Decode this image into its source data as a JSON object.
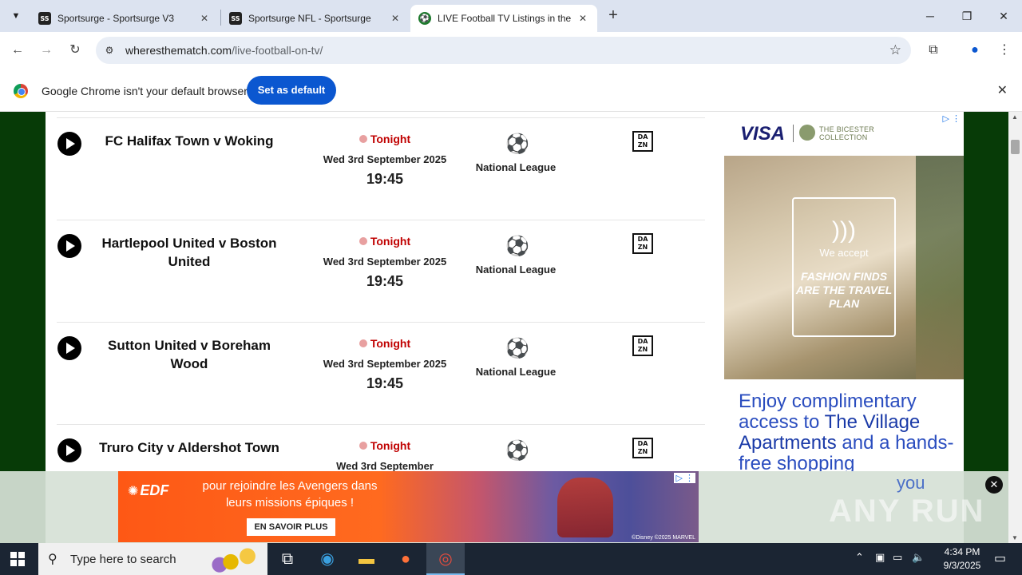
{
  "browser": {
    "tabs": [
      {
        "favicon": "SS",
        "title": "Sportsurge - Sportsurge V3",
        "active": false
      },
      {
        "favicon": "SS",
        "title": "Sportsurge NFL - Sportsurge",
        "active": false
      },
      {
        "favicon": "football-icon",
        "title": "LIVE Football TV Listings in the",
        "active": true
      }
    ],
    "url_host": "wheresthematch.com",
    "url_path": "/live-football-on-tv/"
  },
  "infobar": {
    "message": "Google Chrome isn't your default browser",
    "button": "Set as default"
  },
  "matches": [
    {
      "name": "FC Halifax Town v Woking",
      "status": "Tonight",
      "date": "Wed 3rd September 2025",
      "time": "19:45",
      "competition": "National League",
      "channel": "DAZN"
    },
    {
      "name": "Hartlepool United v Boston United",
      "status": "Tonight",
      "date": "Wed 3rd September 2025",
      "time": "19:45",
      "competition": "National League",
      "channel": "DAZN"
    },
    {
      "name": "Sutton United v Boreham Wood",
      "status": "Tonight",
      "date": "Wed 3rd September 2025",
      "time": "19:45",
      "competition": "National League",
      "channel": "DAZN"
    },
    {
      "name": "Truro City v Aldershot Town",
      "status": "Tonight",
      "date": "Wed 3rd September",
      "time": "",
      "competition": "",
      "channel": "DAZN"
    }
  ],
  "ad_right": {
    "brand": "VISA",
    "partner": "THE BICESTER COLLECTION",
    "card_text": "We accept",
    "card_slogan": "FASHION FINDS ARE THE TRAVEL PLAN",
    "headline_pre": "Enjoy complimentary access to ",
    "headline_bold": "The Village Apartments",
    "headline_post": " and a hands-free shopping",
    "headline_cut": "you"
  },
  "ad_bottom": {
    "brand": "EDF",
    "tagline": "pour rejoindre les Avengers dans leurs missions épiques !",
    "cta": "EN SAVOIR PLUS",
    "copyright": "©Disney ©2025 MARVEL"
  },
  "watermark": "ANY RUN",
  "taskbar": {
    "search_placeholder": "Type here to search",
    "time": "4:34 PM",
    "date": "9/3/2025"
  }
}
